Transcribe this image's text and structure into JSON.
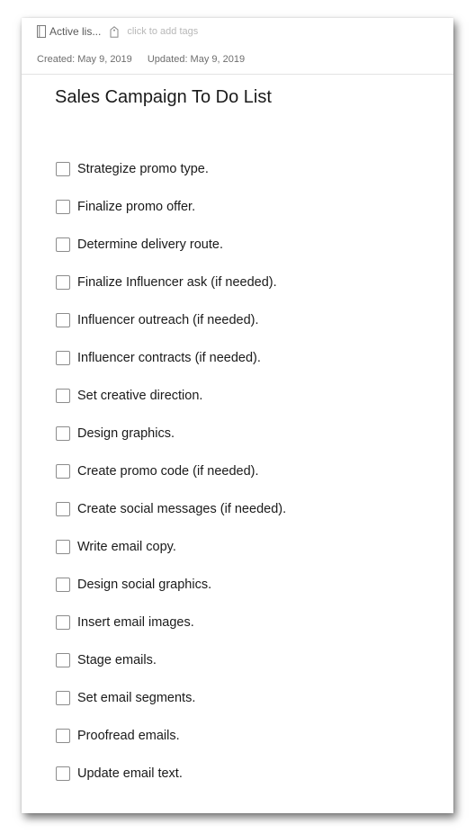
{
  "header": {
    "notebook_icon": "notebook-icon",
    "notebook_name": "Active lis...",
    "tag_icon": "tag-icon",
    "tag_placeholder": "click to add tags",
    "created": "Created: May 9, 2019",
    "updated": "Updated: May 9, 2019"
  },
  "note": {
    "title": "Sales Campaign To Do List",
    "checklist": [
      {
        "label": "Strategize promo type.",
        "checked": false
      },
      {
        "label": "Finalize promo offer.",
        "checked": false
      },
      {
        "label": "Determine delivery route.",
        "checked": false
      },
      {
        "label": "Finalize Influencer ask (if needed).",
        "checked": false
      },
      {
        "label": "Influencer outreach (if needed).",
        "checked": false
      },
      {
        "label": "Influencer contracts (if needed).",
        "checked": false
      },
      {
        "label": "Set creative direction.",
        "checked": false
      },
      {
        "label": "Design graphics.",
        "checked": false
      },
      {
        "label": "Create promo code (if needed).",
        "checked": false
      },
      {
        "label": "Create social messages (if needed).",
        "checked": false
      },
      {
        "label": "Write email copy.",
        "checked": false
      },
      {
        "label": "Design social graphics.",
        "checked": false
      },
      {
        "label": "Insert email images.",
        "checked": false
      },
      {
        "label": "Stage emails.",
        "checked": false
      },
      {
        "label": "Set email segments.",
        "checked": false
      },
      {
        "label": "Proofread emails.",
        "checked": false
      },
      {
        "label": "Update email text.",
        "checked": false
      }
    ]
  }
}
